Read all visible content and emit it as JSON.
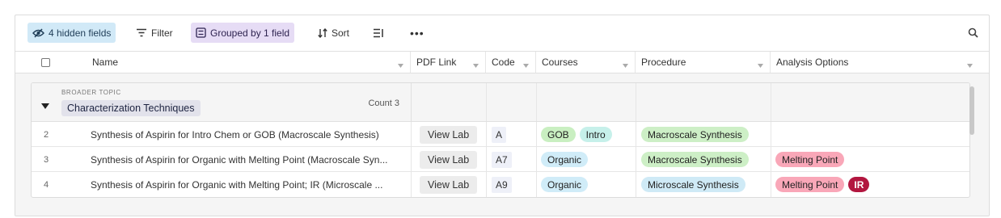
{
  "toolbar": {
    "hidden_fields_label": "4 hidden fields",
    "filter_label": "Filter",
    "grouped_label": "Grouped by 1 field",
    "sort_label": "Sort",
    "more_label": "•••"
  },
  "columns": {
    "name": "Name",
    "pdf_link": "PDF Link",
    "code": "Code",
    "courses": "Courses",
    "procedure": "Procedure",
    "analysis_options": "Analysis Options"
  },
  "group": {
    "label": "BROADER TOPIC",
    "value": "Characterization Techniques",
    "count": "Count 3"
  },
  "rows": [
    {
      "num": "2",
      "name": "Synthesis of Aspirin for Intro Chem or GOB (Macroscale Synthesis)",
      "pdf_link": "View Lab",
      "code": "A",
      "courses": [
        "GOB",
        "Intro"
      ],
      "procedure": "Macroscale Synthesis",
      "analysis": []
    },
    {
      "num": "3",
      "name": "Synthesis of Aspirin for Organic with Melting Point (Macroscale Syn...",
      "pdf_link": "View Lab",
      "code": "A7",
      "courses": [
        "Organic"
      ],
      "procedure": "Macroscale Synthesis",
      "analysis": [
        "Melting Point"
      ]
    },
    {
      "num": "4",
      "name": "Synthesis of Aspirin for Organic with Melting Point; IR (Microscale ...",
      "pdf_link": "View Lab",
      "code": "A9",
      "courses": [
        "Organic"
      ],
      "procedure": "Microscale Synthesis",
      "analysis": [
        "Melting Point",
        "IR"
      ]
    }
  ],
  "colors": {
    "hidden_fields_bg": "#d1e9f7",
    "grouped_bg": "#e6dcf5",
    "GOB": "#c9efc1",
    "Intro": "#c6f0ea",
    "Organic": "#d0ecf8",
    "Macroscale Synthesis": "#cdefc6",
    "Microscale Synthesis": "#cfeaf6",
    "Melting Point": "#f9a7b8",
    "IR": "#b2163f"
  }
}
